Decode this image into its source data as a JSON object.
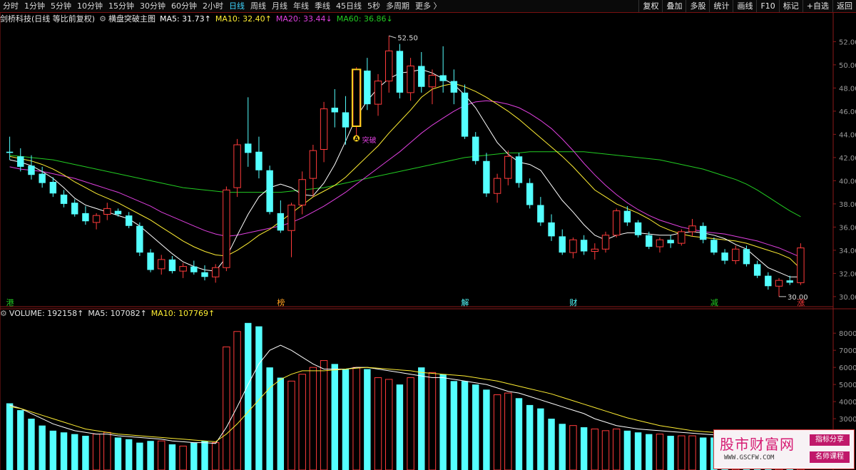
{
  "toolbar": {
    "periods": [
      "分时",
      "1分钟",
      "5分钟",
      "10分钟",
      "15分钟",
      "30分钟",
      "60分钟",
      "2小时",
      "日线",
      "周线",
      "月线",
      "年线",
      "季线",
      "45日线",
      "5秒",
      "多周期",
      "更多 〉"
    ],
    "active_period": "日线",
    "right_buttons": [
      "复权",
      "叠加",
      "多股",
      "统计",
      "画线",
      "F10",
      "标记",
      "+自选",
      "返回"
    ]
  },
  "main_legend": {
    "stock": "剑桥科技(日线 等比前复权)",
    "indicator": "横盘突破主图",
    "ma5": "MA5: 31.73↑",
    "ma10": "MA10: 32.40↑",
    "ma20": "MA20: 33.44↓",
    "ma60": "MA60: 36.86↓"
  },
  "volume_legend": {
    "volume": "VOLUME: 192158↑",
    "ma5": "MA5: 107082↑",
    "ma10": "MA10: 107769↑"
  },
  "annotations": {
    "high_label": "52.50",
    "low_label": "30.00",
    "breakout_label": "突破",
    "breakout_marker": "A"
  },
  "colors": {
    "up": "#ff3b3b",
    "down": "#54ffff",
    "ma5": "#ffffff",
    "ma10": "#ffee33",
    "ma20": "#e040e0",
    "ma60": "#22cc22",
    "axis_text": "#9a9a9a",
    "border": "#8b1a1a"
  },
  "watermark": {
    "title": "股市财富网",
    "url": "WWW.GSCFW.COM",
    "tag1": "指标分享",
    "tag2": "名师课程"
  },
  "chart_data": [
    {
      "type": "candlestick",
      "title": "剑桥科技(日线 等比前复权)",
      "ylim": [
        29.5,
        53.5
      ],
      "yticks": [
        30,
        32,
        34,
        36,
        38,
        40,
        42,
        44,
        46,
        48,
        50,
        52
      ],
      "ohlc": [
        [
          42.5,
          43.8,
          41.8,
          42.4
        ],
        [
          42.1,
          42.8,
          40.8,
          41.2
        ],
        [
          41.3,
          42.2,
          40.1,
          40.5
        ],
        [
          40.6,
          41.2,
          39.4,
          39.8
        ],
        [
          39.9,
          40.3,
          38.6,
          38.9
        ],
        [
          38.8,
          39.2,
          37.7,
          38.0
        ],
        [
          38.1,
          38.4,
          36.9,
          37.1
        ],
        [
          37.2,
          37.8,
          36.2,
          36.5
        ],
        [
          36.4,
          37.2,
          35.8,
          37.0
        ],
        [
          37.1,
          38.1,
          36.6,
          37.6
        ],
        [
          37.4,
          37.6,
          36.9,
          37.1
        ],
        [
          37.0,
          37.3,
          35.9,
          36.1
        ],
        [
          36.1,
          36.4,
          33.5,
          33.8
        ],
        [
          33.8,
          34.1,
          32.1,
          32.3
        ],
        [
          32.4,
          33.6,
          31.9,
          33.2
        ],
        [
          33.2,
          33.5,
          32.0,
          32.2
        ],
        [
          32.2,
          32.9,
          31.6,
          32.6
        ],
        [
          32.6,
          33.1,
          31.9,
          32.1
        ],
        [
          32.1,
          32.7,
          31.4,
          31.7
        ],
        [
          31.7,
          32.8,
          31.2,
          32.5
        ],
        [
          32.5,
          39.5,
          32.2,
          39.2
        ],
        [
          39.4,
          43.6,
          38.6,
          43.1
        ],
        [
          43.2,
          47.2,
          41.2,
          42.4
        ],
        [
          42.5,
          43.8,
          40.2,
          40.9
        ],
        [
          40.9,
          41.3,
          37.1,
          37.3
        ],
        [
          37.2,
          38.3,
          35.5,
          35.7
        ],
        [
          35.7,
          38.1,
          33.4,
          37.9
        ],
        [
          37.9,
          40.8,
          37.1,
          40.1
        ],
        [
          40.2,
          43.1,
          38.6,
          42.6
        ],
        [
          42.7,
          46.8,
          41.6,
          46.2
        ],
        [
          46.3,
          47.9,
          44.6,
          45.9
        ],
        [
          45.9,
          47.3,
          43.1,
          44.6
        ],
        [
          44.7,
          49.8,
          43.9,
          49.6
        ],
        [
          49.5,
          50.6,
          46.1,
          46.6
        ],
        [
          46.6,
          49.2,
          45.6,
          48.6
        ],
        [
          48.6,
          52.5,
          47.6,
          51.2
        ],
        [
          51.2,
          51.8,
          47.1,
          47.6
        ],
        [
          47.6,
          50.6,
          46.9,
          49.9
        ],
        [
          49.9,
          51.1,
          47.6,
          48.1
        ],
        [
          48.1,
          49.6,
          46.6,
          49.1
        ],
        [
          49.1,
          51.6,
          47.6,
          48.6
        ],
        [
          48.6,
          49.6,
          46.6,
          47.6
        ],
        [
          47.6,
          48.3,
          43.6,
          43.8
        ],
        [
          43.8,
          44.2,
          41.4,
          41.7
        ],
        [
          41.7,
          42.4,
          38.6,
          38.9
        ],
        [
          38.9,
          40.6,
          38.1,
          40.2
        ],
        [
          40.2,
          42.6,
          39.6,
          42.1
        ],
        [
          42.1,
          42.4,
          39.4,
          39.8
        ],
        [
          39.8,
          40.2,
          37.6,
          37.9
        ],
        [
          37.9,
          38.6,
          36.1,
          36.4
        ],
        [
          36.4,
          37.1,
          34.8,
          35.2
        ],
        [
          35.2,
          35.8,
          33.6,
          33.8
        ],
        [
          33.8,
          35.1,
          33.3,
          34.9
        ],
        [
          34.9,
          35.3,
          33.6,
          33.9
        ],
        [
          33.9,
          34.6,
          33.2,
          34.1
        ],
        [
          34.1,
          35.6,
          33.8,
          35.3
        ],
        [
          35.3,
          37.6,
          35.1,
          37.4
        ],
        [
          37.4,
          37.8,
          36.1,
          36.4
        ],
        [
          36.4,
          36.6,
          35.1,
          35.3
        ],
        [
          35.3,
          35.6,
          34.1,
          34.3
        ],
        [
          34.3,
          35.1,
          33.8,
          34.9
        ],
        [
          34.9,
          35.3,
          34.2,
          34.6
        ],
        [
          34.6,
          35.8,
          34.4,
          35.6
        ],
        [
          35.6,
          36.7,
          35.2,
          36.1
        ],
        [
          36.1,
          36.4,
          34.6,
          34.9
        ],
        [
          34.9,
          35.1,
          33.6,
          33.8
        ],
        [
          33.8,
          34.1,
          32.8,
          33.1
        ],
        [
          33.1,
          34.4,
          32.8,
          34.1
        ],
        [
          34.1,
          34.4,
          32.6,
          32.8
        ],
        [
          32.8,
          33.1,
          31.6,
          31.8
        ],
        [
          31.8,
          32.1,
          30.6,
          30.9
        ],
        [
          30.9,
          31.6,
          30.0,
          31.4
        ],
        [
          31.4,
          31.8,
          31.0,
          31.2
        ],
        [
          31.2,
          34.6,
          31.0,
          34.2
        ]
      ],
      "ma5": [
        41.8,
        41.6,
        41.3,
        40.8,
        40.2,
        39.4,
        38.5,
        37.9,
        37.6,
        37.3,
        37.0,
        36.7,
        36.1,
        35.3,
        34.5,
        33.7,
        33.0,
        32.6,
        32.3,
        32.2,
        33.4,
        35.3,
        37.1,
        38.6,
        39.4,
        39.7,
        39.4,
        38.8,
        38.7,
        39.8,
        41.4,
        43.4,
        45.5,
        46.9,
        48.0,
        48.8,
        49.3,
        49.4,
        49.6,
        49.3,
        48.8,
        48.3,
        47.4,
        46.3,
        44.8,
        43.3,
        42.3,
        41.6,
        41.4,
        40.9,
        39.6,
        38.3,
        37.3,
        36.2,
        35.3,
        34.9,
        35.3,
        35.5,
        35.5,
        35.4,
        35.3,
        35.3,
        35.5,
        35.6,
        35.5,
        35.3,
        35.0,
        34.5,
        34.1,
        33.3,
        32.5,
        32.1,
        31.7,
        31.7
      ],
      "ma10": [
        42.1,
        41.9,
        41.7,
        41.4,
        41.0,
        40.5,
        39.9,
        39.4,
        38.9,
        38.5,
        38.1,
        37.6,
        37.1,
        36.6,
        36.0,
        35.4,
        34.8,
        34.3,
        33.9,
        33.6,
        33.5,
        34.0,
        34.6,
        35.3,
        35.8,
        36.5,
        37.2,
        37.9,
        38.6,
        39.1,
        39.6,
        40.3,
        41.2,
        42.1,
        43.0,
        44.1,
        45.1,
        46.1,
        47.2,
        47.9,
        48.2,
        48.4,
        48.1,
        47.7,
        47.2,
        46.6,
        46.0,
        45.3,
        44.5,
        43.7,
        42.9,
        42.1,
        41.2,
        40.2,
        39.2,
        38.6,
        38.0,
        37.6,
        37.2,
        36.7,
        36.1,
        35.7,
        35.4,
        35.2,
        35.1,
        35.0,
        34.9,
        34.8,
        34.6,
        34.3,
        34.0,
        33.7,
        33.3,
        32.4
      ],
      "ma20": [
        41.2,
        41.0,
        40.9,
        40.8,
        40.6,
        40.4,
        40.2,
        39.9,
        39.6,
        39.3,
        39.0,
        38.6,
        38.2,
        37.8,
        37.3,
        36.9,
        36.5,
        36.1,
        35.7,
        35.4,
        35.2,
        35.3,
        35.5,
        35.7,
        35.9,
        36.1,
        36.4,
        36.8,
        37.3,
        37.8,
        38.4,
        39.0,
        39.7,
        40.4,
        41.1,
        41.8,
        42.5,
        43.3,
        44.1,
        44.8,
        45.4,
        46.0,
        46.5,
        46.8,
        46.9,
        46.8,
        46.6,
        46.3,
        45.8,
        45.2,
        44.5,
        43.6,
        42.6,
        41.5,
        40.5,
        39.6,
        38.8,
        38.1,
        37.5,
        37.0,
        36.6,
        36.3,
        36.0,
        35.8,
        35.6,
        35.5,
        35.4,
        35.2,
        35.0,
        34.8,
        34.5,
        34.2,
        33.8,
        33.4
      ],
      "ma60": [
        42.2,
        42.1,
        42.0,
        41.9,
        41.8,
        41.6,
        41.4,
        41.2,
        41.0,
        40.8,
        40.6,
        40.4,
        40.2,
        40.0,
        39.8,
        39.6,
        39.4,
        39.3,
        39.2,
        39.1,
        39.0,
        39.0,
        39.0,
        39.0,
        39.0,
        39.0,
        39.1,
        39.2,
        39.3,
        39.4,
        39.6,
        39.8,
        40.0,
        40.2,
        40.4,
        40.6,
        40.8,
        41.0,
        41.2,
        41.4,
        41.6,
        41.8,
        42.0,
        42.1,
        42.2,
        42.3,
        42.4,
        42.4,
        42.5,
        42.5,
        42.5,
        42.5,
        42.5,
        42.5,
        42.4,
        42.3,
        42.2,
        42.1,
        42.0,
        41.9,
        41.8,
        41.6,
        41.4,
        41.2,
        41.0,
        40.7,
        40.4,
        40.1,
        39.7,
        39.2,
        38.6,
        38.0,
        37.4,
        36.9
      ]
    },
    {
      "type": "bar",
      "title": "VOLUME",
      "ylim": [
        0,
        8800
      ],
      "yticks": [
        3000,
        4000,
        5000,
        6000,
        7000,
        8000
      ],
      "values": [
        3900,
        3500,
        3000,
        2600,
        2300,
        2200,
        2100,
        2000,
        2100,
        2200,
        1900,
        1800,
        1600,
        1700,
        1700,
        1500,
        1400,
        1600,
        1700,
        1600,
        7200,
        8100,
        8600,
        8400,
        6000,
        5400,
        5200,
        5600,
        6000,
        6400,
        6200,
        5900,
        6000,
        5900,
        5400,
        5300,
        5000,
        5400,
        6000,
        5700,
        5600,
        5200,
        5200,
        5000,
        4700,
        4400,
        4500,
        4200,
        3800,
        3600,
        3000,
        2700,
        2600,
        2500,
        2400,
        2300,
        2400,
        2300,
        2200,
        2100,
        2100,
        2000,
        2000,
        2000,
        1900,
        1900,
        2100,
        2100,
        2000,
        2000,
        2000,
        1900,
        1900,
        2100
      ],
      "ma5": [
        3800,
        3600,
        3300,
        3000,
        2700,
        2500,
        2300,
        2200,
        2100,
        2100,
        2000,
        1950,
        1900,
        1850,
        1800,
        1700,
        1650,
        1600,
        1600,
        1550,
        2500,
        3700,
        5000,
        6200,
        7000,
        7300,
        7000,
        6600,
        6200,
        5900,
        5900,
        5900,
        6000,
        6000,
        5900,
        5800,
        5700,
        5600,
        5500,
        5400,
        5400,
        5300,
        5200,
        5100,
        5000,
        4800,
        4600,
        4500,
        4300,
        4100,
        3900,
        3700,
        3500,
        3300,
        3000,
        2800,
        2600,
        2500,
        2400,
        2350,
        2300,
        2250,
        2200,
        2150,
        2100,
        2050,
        2050,
        2050,
        2050,
        2030,
        2020,
        2000,
        1980,
        1990
      ],
      "ma10": [
        3700,
        3600,
        3400,
        3200,
        3000,
        2800,
        2600,
        2400,
        2300,
        2200,
        2100,
        2050,
        2000,
        1950,
        1900,
        1850,
        1800,
        1750,
        1700,
        1650,
        2100,
        2700,
        3400,
        4100,
        4800,
        5300,
        5600,
        5800,
        5800,
        5800,
        5850,
        5900,
        5950,
        6000,
        5950,
        5900,
        5850,
        5800,
        5700,
        5650,
        5600,
        5550,
        5500,
        5400,
        5300,
        5200,
        5050,
        4900,
        4750,
        4600,
        4450,
        4250,
        4050,
        3850,
        3650,
        3450,
        3250,
        3050,
        2900,
        2750,
        2600,
        2500,
        2400,
        2300,
        2250,
        2200,
        2150,
        2100,
        2080,
        2060,
        2040,
        2020,
        2010,
        2000
      ]
    }
  ],
  "event_markers": [
    "港",
    "榜",
    "解",
    "财",
    "减",
    "涨"
  ]
}
